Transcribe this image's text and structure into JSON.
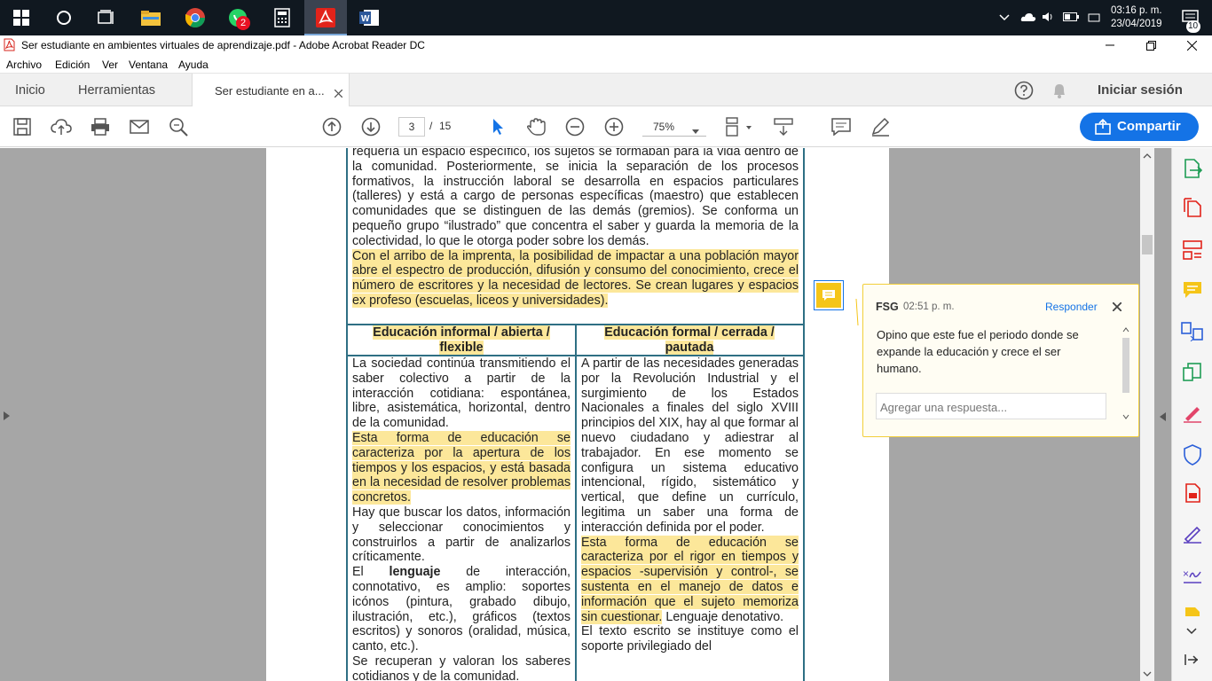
{
  "taskbar": {
    "whatsapp_badge": "2",
    "time": "03:16 p. m.",
    "date": "23/04/2019",
    "notification_count": "10"
  },
  "window": {
    "title": "Ser estudiante en ambientes virtuales de aprendizaje.pdf - Adobe Acrobat Reader DC"
  },
  "menu": {
    "items": [
      "Archivo",
      "Edición",
      "Ver",
      "Ventana",
      "Ayuda"
    ]
  },
  "tabs": {
    "home": "Inicio",
    "tools": "Herramientas",
    "document": "Ser estudiante en a...",
    "signin": "Iniciar sesión"
  },
  "toolbar": {
    "current_page": "3",
    "page_separator": "/",
    "total_pages": "15",
    "zoom": "75%",
    "share_label": "Compartir"
  },
  "document": {
    "intro_1": "requería un espacio específico, los sujetos se formaban para la vida dentro de la comunidad. Posteriormente, se inicia la separación de los procesos formativos, la instrucción laboral se desarrolla en espacios particulares (talleres) y está a cargo de personas específicas (maestro) que establecen comunidades que se distinguen de las demás (gremios). Se conforma un pequeño grupo “ilustrado” que concentra el saber y guarda la memoria de la colectividad, lo que le otorga poder sobre los demás.",
    "intro_2": "Con el arribo de la imprenta, la posibilidad de impactar a una población mayor abre el espectro de producción, difusión y consumo del conocimiento, crece el número de escritores y la necesidad de lectores. Se crean lugares y espacios ex profeso (escuelas, liceos y universidades).",
    "col1_header": "Educación informal / abierta / flexible",
    "col2_header": "Educación formal / cerrada / pautada",
    "col1_p1": "La sociedad continúa transmitiendo el saber colectivo a partir de la interacción cotidiana: espontánea, libre, asistemática, horizontal, dentro de la comunidad.",
    "col1_p2": "Esta forma de educación se caracteriza por la apertura de los tiempos y los espacios, y está basada en la necesidad de resolver problemas concretos.",
    "col1_p3": "Hay que buscar los datos, información y seleccionar conocimientos y construirlos a partir de analizarlos críticamente.",
    "col1_p4_a": "El ",
    "col1_p4_bold": "lenguaje",
    "col1_p4_b": " de interacción, connotativo, es amplio: soportes icónos (pintura, grabado dibujo, ilustración, etc.), gráficos (textos escritos) y sonoros (oralidad, música, canto, etc.).",
    "col1_p5": "Se recuperan y valoran los saberes cotidianos y de la comunidad.",
    "col2_p1": "A partir de las necesidades generadas por la Revolución Industrial y el surgimiento de los Estados Nacionales a finales del siglo XVIII principios del XIX, hay al que formar al nuevo ciudadano y adiestrar al trabajador. En ese momento se configura un sistema educativo intencional, rígido, sistemático y vertical, que define un currículo, legitima un saber una forma de interacción definida por el poder.",
    "col2_p2": "Esta forma de educación se caracteriza por el rigor en tiempos y espacios -supervisión y control-, se sustenta en el manejo de datos e información que el sujeto memoriza sin cuestionar.",
    "col2_p2_tail": " Lenguaje denotativo.",
    "col2_p3": "El texto escrito se instituye como el soporte privilegiado del"
  },
  "comment": {
    "author": "FSG",
    "time": "02:51 p. m.",
    "reply_link": "Responder",
    "text": "Opino que este fue el periodo donde se expande la educación y crece el ser humano.",
    "reply_placeholder": "Agregar una respuesta..."
  },
  "colors": {
    "accent": "#1473e6",
    "highlight": "#fce79a",
    "table_border": "#2e6f84",
    "note_yellow": "#f5c518"
  }
}
